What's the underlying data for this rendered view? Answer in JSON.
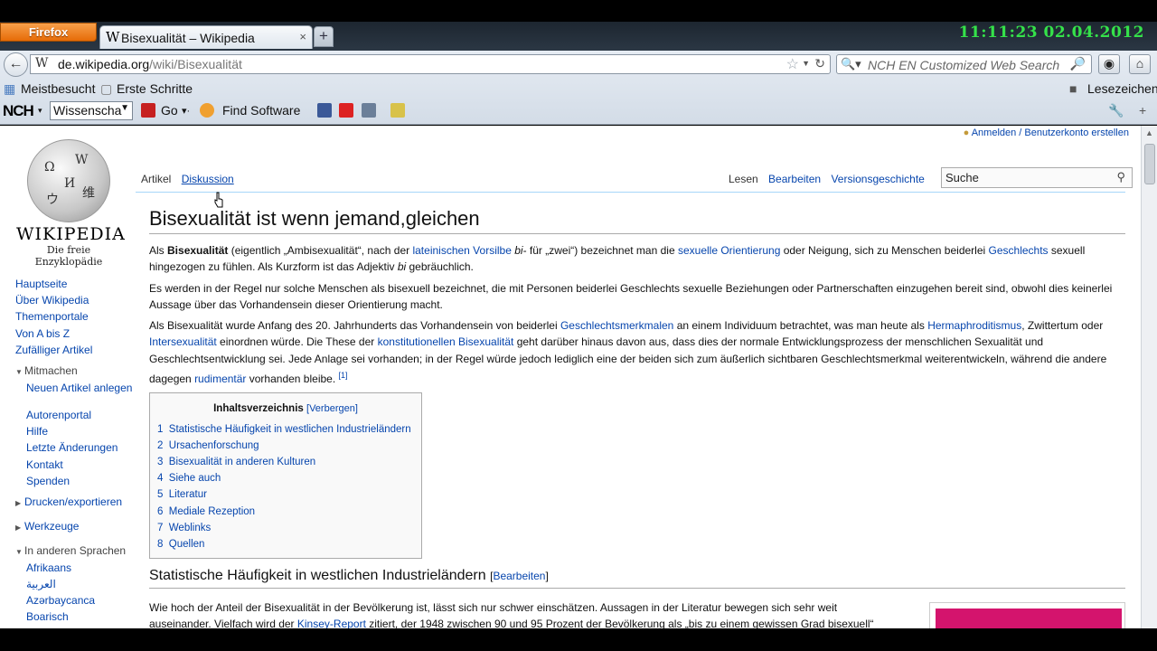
{
  "clock": "11:11:23 02.04.2012",
  "browser": {
    "menu_label": "Firefox",
    "tab_title": "Bisexualität – Wikipedia",
    "url_host": "de.wikipedia.org",
    "url_path": "/wiki/Bisexualität",
    "search_placeholder": "NCH EN Customized Web Search",
    "bookmarks": [
      "Meistbesucht",
      "Erste Schritte"
    ],
    "bookmarks_right": "Lesezeichen",
    "toolbar": {
      "brand": "NCH",
      "select_value": "Wissenscha",
      "go_label": "Go",
      "find_software_label": "Find Software"
    }
  },
  "wiki": {
    "logo_wordmark": "Wikipedia",
    "logo_subtitle": "Die freie Enzyklopädie",
    "personal_link": "Anmelden / Benutzerkonto erstellen",
    "tabs_left": [
      "Artikel",
      "Diskussion"
    ],
    "tabs_right": [
      "Lesen",
      "Bearbeiten",
      "Versionsgeschichte"
    ],
    "search_placeholder": "Suche",
    "nav": [
      "Hauptseite",
      "Über Wikipedia",
      "Themenportale",
      "Von A bis Z",
      "Zufälliger Artikel"
    ],
    "mitmachen_title": "Mitmachen",
    "mitmachen_items": [
      "Neuen Artikel anlegen",
      "Autorenportal",
      "Hilfe",
      "Letzte Änderungen",
      "Kontakt",
      "Spenden"
    ],
    "drucken_title": "Drucken/exportieren",
    "werkzeuge_title": "Werkzeuge",
    "sprachen_title": "In anderen Sprachen",
    "sprachen_items": [
      "Afrikaans",
      "العربية",
      "Azərbaycanca",
      "Boarisch"
    ],
    "heading": "Bisexualität ist wenn jemand,gleichen",
    "toc_title": "Inhaltsverzeichnis",
    "toc_hide": "[Verbergen]",
    "toc_items": [
      "1  Statistische Häufigkeit in westlichen Industrieländern",
      "2  Ursachenforschung",
      "3  Bisexualität in anderen Kulturen",
      "4  Siehe auch",
      "5  Literatur",
      "6  Mediale Rezeption",
      "7  Weblinks",
      "8  Quellen"
    ],
    "section_heading": "Statistische Häufigkeit in westlichen Industrieländern",
    "section_edit_open": "[",
    "section_edit": "Bearbeiten",
    "section_edit_close": "]",
    "p1": {
      "a": "Als ",
      "b": "Bisexualität",
      "c": " (eigentlich „Ambisexualität“, nach der ",
      "l1": "lateinischen Vorsilbe",
      "d": " ",
      "e": "bi",
      "f": "- für „zwei“) bezeichnet man die ",
      "l2": "sexuelle Orientierung",
      "g": " oder Neigung, sich zu Menschen beiderlei ",
      "l3": "Geschlechts",
      "h": " sexuell hingezogen zu fühlen. Als Kurzform ist das Adjektiv ",
      "i": "bi",
      "j": " gebräuchlich."
    },
    "p2": "Es werden in der Regel nur solche Menschen als bisexuell bezeichnet, die mit Personen beiderlei Geschlechts sexuelle Beziehungen oder Partnerschaften einzugehen bereit sind, obwohl dies keinerlei Aussage über das Vorhandensein dieser Orientierung macht.",
    "p3": {
      "a": "Als Bisexualität wurde Anfang des 20. Jahrhunderts das Vorhandensein von beiderlei ",
      "l1": "Geschlechtsmerkmalen",
      "b": " an einem Individuum betrachtet, was man heute als ",
      "l2": "Hermaphroditismus",
      "c": ", Zwittertum oder ",
      "l3": "Intersexualität",
      "d": " einordnen würde. Die These der ",
      "l4": "konstitutionellen Bisexualität",
      "e": " geht darüber hinaus davon aus, dass dies der normale Entwicklungsprozess der menschlichen Sexualität und Geschlechtsentwicklung sei. Jede Anlage sei vorhanden; in der Regel würde jedoch lediglich eine der beiden sich zum äußerlich sichtbaren Geschlechtsmerkmal weiterentwickeln, während die andere dagegen ",
      "l5": "rudimentär",
      "f": " vorhanden bleibe. ",
      "ref": "[1]"
    },
    "p4": {
      "a": "Wie hoch der Anteil der Bisexualität in der Bevölkerung ist, lässt sich nur schwer einschätzen. Aussagen in der Literatur bewegen sich sehr weit auseinander. Vielfach wird der ",
      "l1": "Kinsey-Report",
      "b": " zitiert, der 1948 zwischen 90 und 95 Prozent der Bevölkerung als „bis zu einem gewissen Grad bisexuell“"
    }
  }
}
